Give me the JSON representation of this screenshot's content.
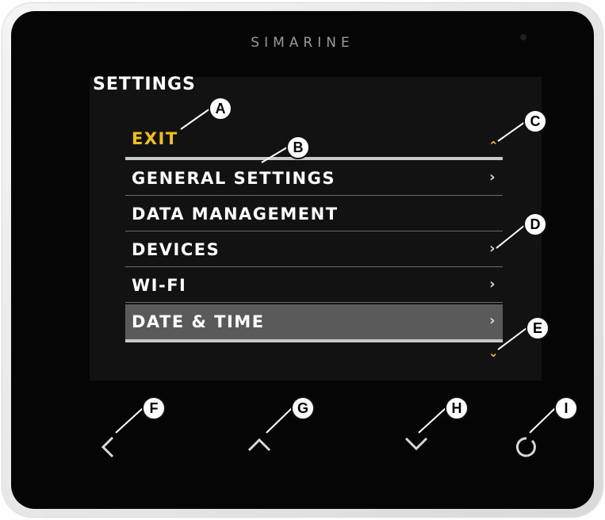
{
  "brand": "SIMARINE",
  "screen": {
    "title": "SETTINGS",
    "exit_label": "EXIT",
    "items": [
      {
        "label": "GENERAL SETTINGS",
        "arrow": "›"
      },
      {
        "label": "DATA MANAGEMENT",
        "arrow": ""
      },
      {
        "label": "DEVICES",
        "arrow": "›"
      },
      {
        "label": "WI-FI",
        "arrow": "›"
      },
      {
        "label": "DATE & TIME",
        "arrow": "›"
      }
    ],
    "selected_item": "DATE & TIME",
    "scroll_up_icon": "chevron-up-icon",
    "scroll_down_icon": "chevron-down-icon"
  },
  "callouts": [
    "A",
    "B",
    "C",
    "D",
    "E",
    "F",
    "G",
    "H",
    "I"
  ],
  "buttons": [
    {
      "name": "back-button",
      "icon": "chevron-left-icon"
    },
    {
      "name": "up-button",
      "icon": "chevron-up-icon"
    },
    {
      "name": "down-button",
      "icon": "chevron-down-icon"
    },
    {
      "name": "select-button",
      "icon": "circle-icon"
    }
  ],
  "colors": {
    "accent": "#f3c019",
    "selected": "#5a5a5a",
    "device": "#050505"
  }
}
